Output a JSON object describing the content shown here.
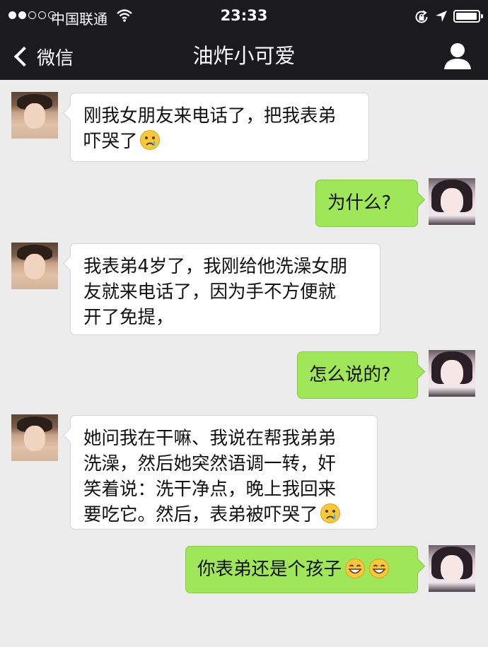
{
  "status_bar": {
    "carrier": "中国联通",
    "time": "23:33",
    "signal_bars_filled": 2,
    "signal_bars_total": 5,
    "battery_level": 0.95
  },
  "nav": {
    "back_label": "微信",
    "title": "油炸小可爱",
    "back_icon": "chevron-left-icon",
    "profile_icon": "person-icon"
  },
  "colors": {
    "background": "#ececec",
    "navbar": "#1b1b1d",
    "bubble_left": "#ffffff",
    "bubble_right": "#9fe658"
  },
  "messages": [
    {
      "side": "left",
      "lines": [
        "刚我女朋友来电话了，把我表弟",
        "吓哭了"
      ],
      "emoji": [
        "crying-face"
      ]
    },
    {
      "side": "right",
      "lines": [
        "为什么?"
      ],
      "emoji": []
    },
    {
      "side": "left",
      "lines": [
        "我表弟4岁了，我刚给他洗澡女朋",
        "友就来电话了，因为手不方便就",
        "开了免提，"
      ],
      "emoji": []
    },
    {
      "side": "right",
      "lines": [
        "怎么说的?"
      ],
      "emoji": []
    },
    {
      "side": "left",
      "lines": [
        "她问我在干嘛、我说在帮我弟弟",
        "洗澡，然后她突然语调一转，奸",
        "笑着说：洗干净点，晚上我回来",
        "要吃它。然后，表弟被吓哭了"
      ],
      "emoji": [
        "crying-face"
      ]
    },
    {
      "side": "right",
      "lines": [
        "你表弟还是个孩子"
      ],
      "emoji": [
        "grinning-face",
        "grinning-face"
      ]
    }
  ]
}
